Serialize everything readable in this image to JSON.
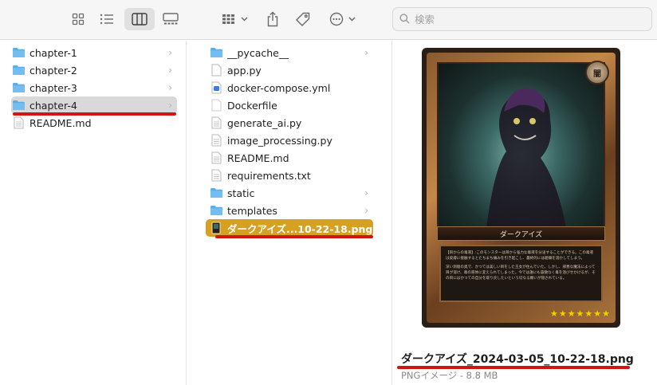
{
  "toolbar": {
    "view_icons": [
      "grid-view-icon",
      "list-view-icon",
      "column-view-icon",
      "gallery-view-icon"
    ],
    "group_icon": "group-by-icon",
    "share_icon": "share-icon",
    "tag_icon": "tag-icon",
    "more_icon": "more-actions-icon",
    "search_placeholder": "検索"
  },
  "column1": {
    "items": [
      {
        "label": "chapter-1",
        "kind": "folder"
      },
      {
        "label": "chapter-2",
        "kind": "folder"
      },
      {
        "label": "chapter-3",
        "kind": "folder"
      },
      {
        "label": "chapter-4",
        "kind": "folder",
        "selected": true
      },
      {
        "label": "README.md",
        "kind": "file"
      }
    ]
  },
  "column2": {
    "items": [
      {
        "label": "__pycache__",
        "kind": "folder"
      },
      {
        "label": "app.py",
        "kind": "file"
      },
      {
        "label": "docker-compose.yml",
        "kind": "yml"
      },
      {
        "label": "Dockerfile",
        "kind": "file"
      },
      {
        "label": "generate_ai.py",
        "kind": "file"
      },
      {
        "label": "image_processing.py",
        "kind": "file"
      },
      {
        "label": "README.md",
        "kind": "file"
      },
      {
        "label": "requirements.txt",
        "kind": "file"
      },
      {
        "label": "static",
        "kind": "folder"
      },
      {
        "label": "templates",
        "kind": "folder"
      },
      {
        "label": "ダークアイズ...10-22-18.png",
        "kind": "image",
        "selected": true
      }
    ]
  },
  "preview": {
    "card": {
      "name": "ダークアイズ",
      "badge": "闇",
      "stars": "★★★★★★★",
      "text_1": "【目からの毒液】:このモンスターは目から強力な毒液を分泌することができる。この毒液は皮膚に接触するとたちまち痛みを引き起こし、最終的には組織を溶かしてしまう。",
      "text_2": "深い洞窟の奥で、かつては美しい目をした王女が住んでいた。しかし、邪悪な魔法によって目が溶け、毒の液体に変えられてしまった。今では誰にも容赦なく毒を浴びせかけるが、その目にはかつての自分を取り戻したいという切なる願いが隠されている。"
    },
    "filename": "ダークアイズ_2024-03-05_10-22-18.png",
    "meta": "PNGイメージ - 8.8 MB"
  },
  "colors": {
    "folder": "#5aaee8",
    "selection_gold": "#d6a021",
    "selection_gray": "#d9d9d9",
    "annotation_red": "#d11414"
  }
}
